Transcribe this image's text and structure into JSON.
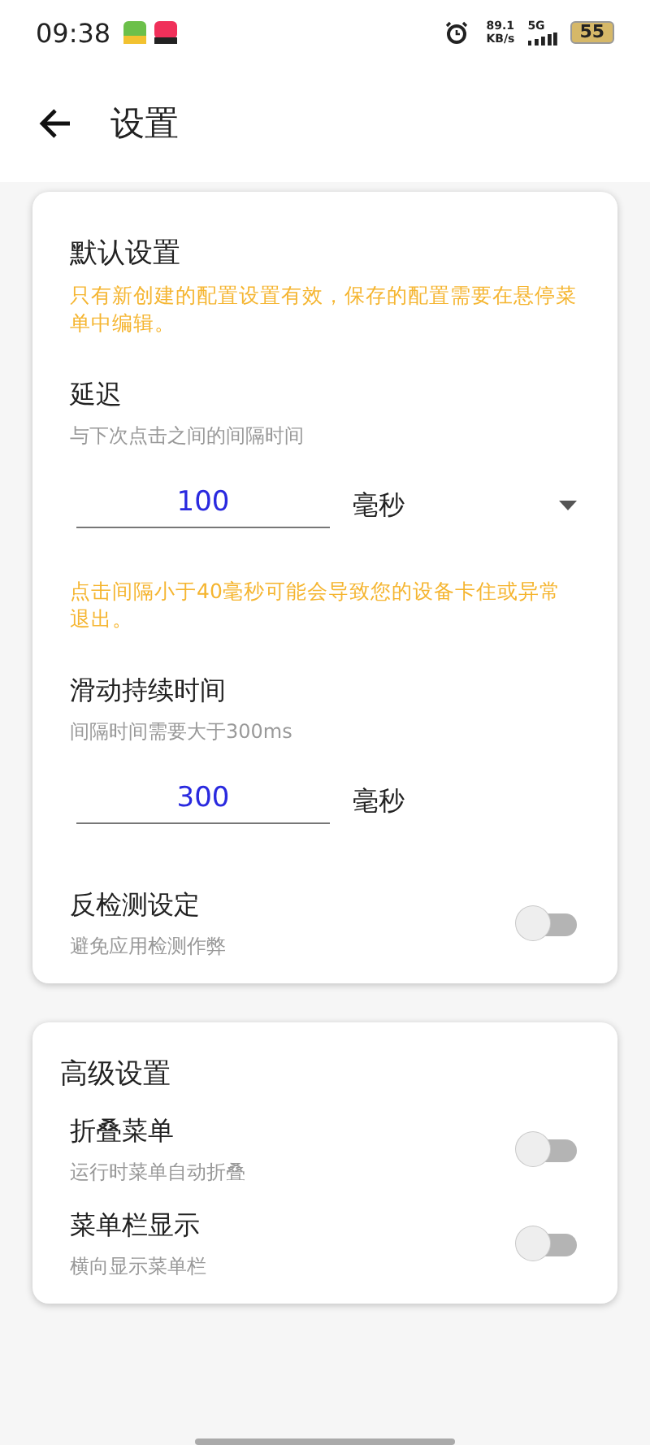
{
  "status_bar": {
    "time": "09:38",
    "speed_value": "89.1",
    "speed_unit": "KB/s",
    "network": "5G",
    "battery": "55"
  },
  "header": {
    "title": "设置"
  },
  "sections": [
    {
      "title": "默认设置",
      "note": "只有新创建的配置设置有效，保存的配置需要在悬停菜单中编辑。",
      "items": [
        {
          "kind": "input",
          "title": "延迟",
          "subtitle": "与下次点击之间的间隔时间",
          "value": "100",
          "unit": "毫秒",
          "dropdown": true,
          "warning": "点击间隔小于40毫秒可能会导致您的设备卡住或异常退出。"
        },
        {
          "kind": "input",
          "title": "滑动持续时间",
          "subtitle": "间隔时间需要大于300ms",
          "value": "300",
          "unit": "毫秒",
          "dropdown": false
        },
        {
          "kind": "switch",
          "title": "反检测设定",
          "subtitle": "避免应用检测作弊",
          "on": false
        }
      ]
    },
    {
      "title": "高级设置",
      "items": [
        {
          "kind": "switch",
          "title": "折叠菜单",
          "subtitle": "运行时菜单自动折叠",
          "on": false
        },
        {
          "kind": "switch",
          "title": "菜单栏显示",
          "subtitle": "横向显示菜单栏",
          "on": false
        }
      ]
    }
  ]
}
